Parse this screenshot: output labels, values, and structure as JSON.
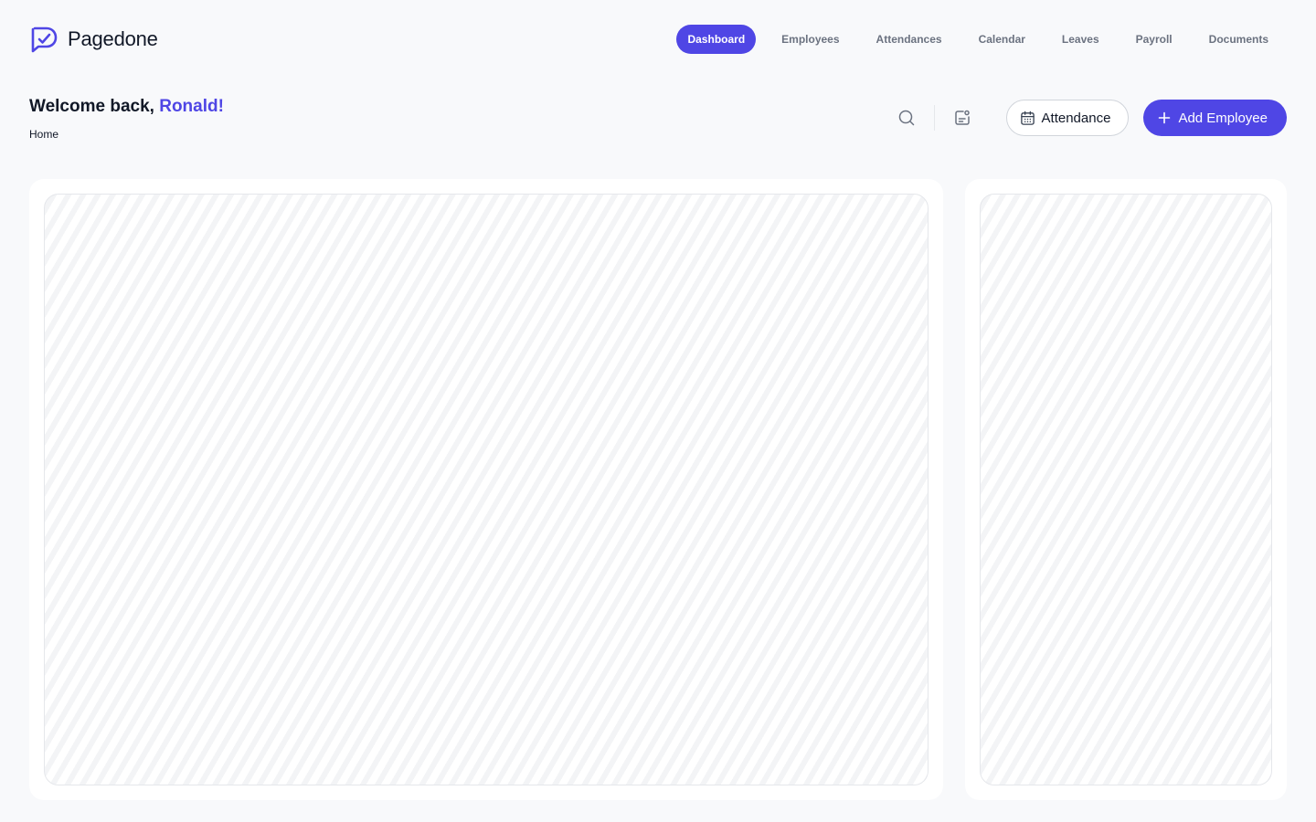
{
  "brand": {
    "name": "Pagedone"
  },
  "nav": {
    "items": [
      {
        "label": "Dashboard",
        "active": true
      },
      {
        "label": "Employees",
        "active": false
      },
      {
        "label": "Attendances",
        "active": false
      },
      {
        "label": "Calendar",
        "active": false
      },
      {
        "label": "Leaves",
        "active": false
      },
      {
        "label": "Payroll",
        "active": false
      },
      {
        "label": "Documents",
        "active": false
      }
    ]
  },
  "welcome": {
    "prefix": "Welcome back, ",
    "name": "Ronald!",
    "breadcrumb": "Home"
  },
  "actions": {
    "search_icon": "search-icon",
    "notes_icon": "notes-icon",
    "attendance_label": "Attendance",
    "add_employee_label": "Add Employee"
  },
  "colors": {
    "accent": "#4f46e5",
    "background": "#f8f9fb",
    "text": "#111827",
    "muted": "#6b7280"
  }
}
